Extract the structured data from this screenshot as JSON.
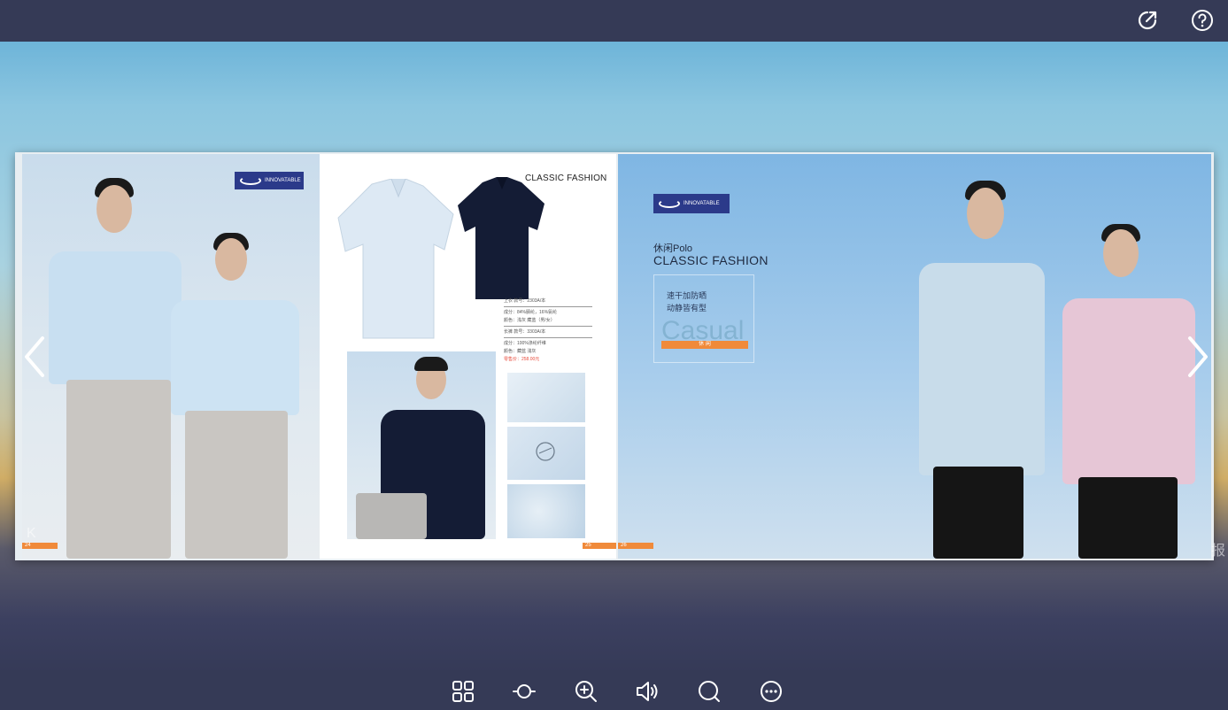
{
  "toolbar_top": {
    "share_icon": "share-icon",
    "help_icon": "help-icon"
  },
  "left_spread": {
    "brand_logo_text": "INNOVATABLE",
    "page_number_left": "24",
    "page_number_right": "25",
    "catalog_title": "CLASSIC FASHION",
    "spec": {
      "line1": "上衣  款号：2303A/本",
      "line2": "成分：84%腈纶，16%氨纶",
      "line3": "颜色：浅灰 藏蓝（男/女）",
      "line4": "长裤  款号：3303A/本",
      "line5": "成分：100%涤纶纤维",
      "line6": "颜色：藏蓝 浅灰",
      "price": "零售价：258.00元"
    }
  },
  "right_spread": {
    "brand_logo_text": "INNOVATABLE",
    "subtitle": "休闲Polo",
    "title": "CLASSIC FASHION",
    "tagline1": "速干加防晒",
    "tagline2": "动静皆有型",
    "casual_word": "Casual",
    "casual_bar": "休 闲",
    "page_number": "26"
  },
  "corner_left": "K",
  "corner_right": "报",
  "toolbar_bottom": {
    "thumbnails_icon": "grid-icon",
    "autoplay_icon": "autoplay-icon",
    "zoom_icon": "zoom-in-icon",
    "sound_icon": "sound-icon",
    "search_icon": "search-icon",
    "more_icon": "more-icon"
  }
}
